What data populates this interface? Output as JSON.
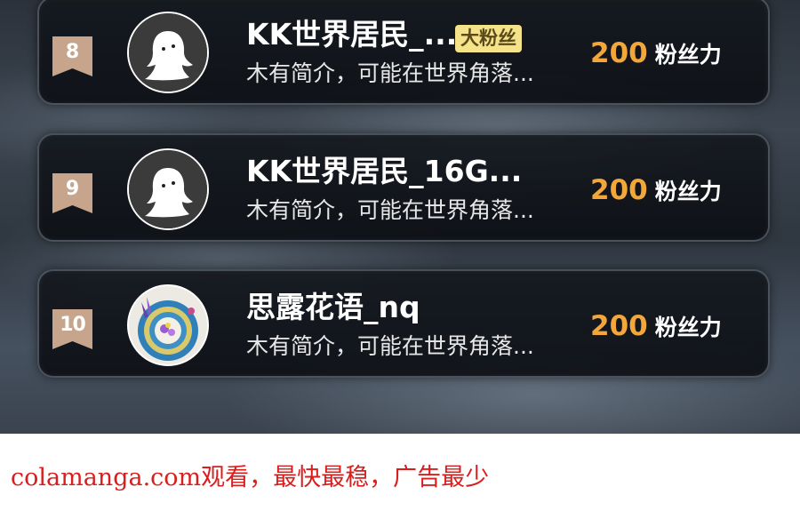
{
  "leaderboard": {
    "entries": [
      {
        "rank": "8",
        "name": "KK世界居民_...",
        "badge": "大粉丝",
        "bio": "木有简介，可能在世界角落...",
        "score": "200",
        "unit": "粉丝力",
        "avatar": "ghost-avatar-icon"
      },
      {
        "rank": "9",
        "name": "KK世界居民_16G...",
        "badge": "",
        "bio": "木有简介，可能在世界角落...",
        "score": "200",
        "unit": "粉丝力",
        "avatar": "ghost-avatar-icon"
      },
      {
        "rank": "10",
        "name": "思露花语_nq",
        "badge": "",
        "bio": "木有简介，可能在世界角落...",
        "score": "200",
        "unit": "粉丝力",
        "avatar": "flower-cup-avatar-icon"
      }
    ]
  },
  "footer": {
    "text": "colamanga.com观看，最快最稳，广告最少"
  },
  "colors": {
    "rank_tag": "#c6a58c",
    "score": "#f3a73b",
    "badge_bg": "#f5e38a",
    "footer_text": "#d91e1e"
  }
}
